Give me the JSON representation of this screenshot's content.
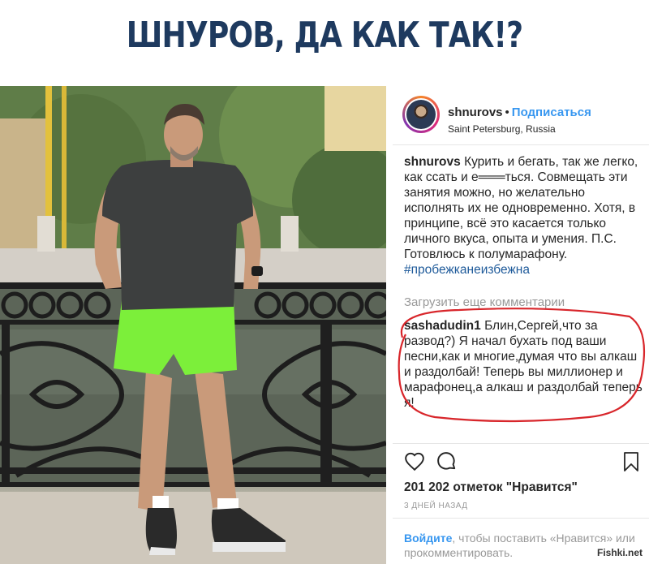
{
  "headline": "ШНУРОВ, ДА КАК ТАК!?",
  "post": {
    "username": "shnurovs",
    "separator": "•",
    "follow_label": "Подписаться",
    "location": "Saint Petersburg, Russia",
    "caption_user": "shnurovs",
    "caption_text": "Курить и бегать, так же легко, как ссать и е═══ться. Совмещать эти занятия можно, но желательно исполнять их не одновременно. Хотя, в принципе, всё это касается только личного вкуса, опыта и умения. П.С. Готовлюсь к полумарафону.",
    "hashtag": "#пробежканеизбежна",
    "load_more": "Загрузить еще комментарии",
    "comment_user": "sashadudin1",
    "comment_text": "Блин,Сергей,что за развод?) Я начал бухать под ваши песни,как и многие,думая что вы алкаш и раздолбай! Теперь вы миллионер и марафонец,а алкаш и раздолбай теперь я!",
    "likes": "201 202 отметок \"Нравится\"",
    "time_ago": "3 дней назад",
    "login_link": "Войдите",
    "login_text": ", чтобы поставить «Нравится» или прокомментировать."
  },
  "icons": {
    "like": "heart-icon",
    "comment": "comment-icon",
    "save": "bookmark-icon"
  },
  "colors": {
    "headline": "#1e3a5f",
    "link": "#3897f0",
    "hashtag": "#1e5a9a",
    "annotation": "#d8262b"
  },
  "watermark": "Fishki.net"
}
